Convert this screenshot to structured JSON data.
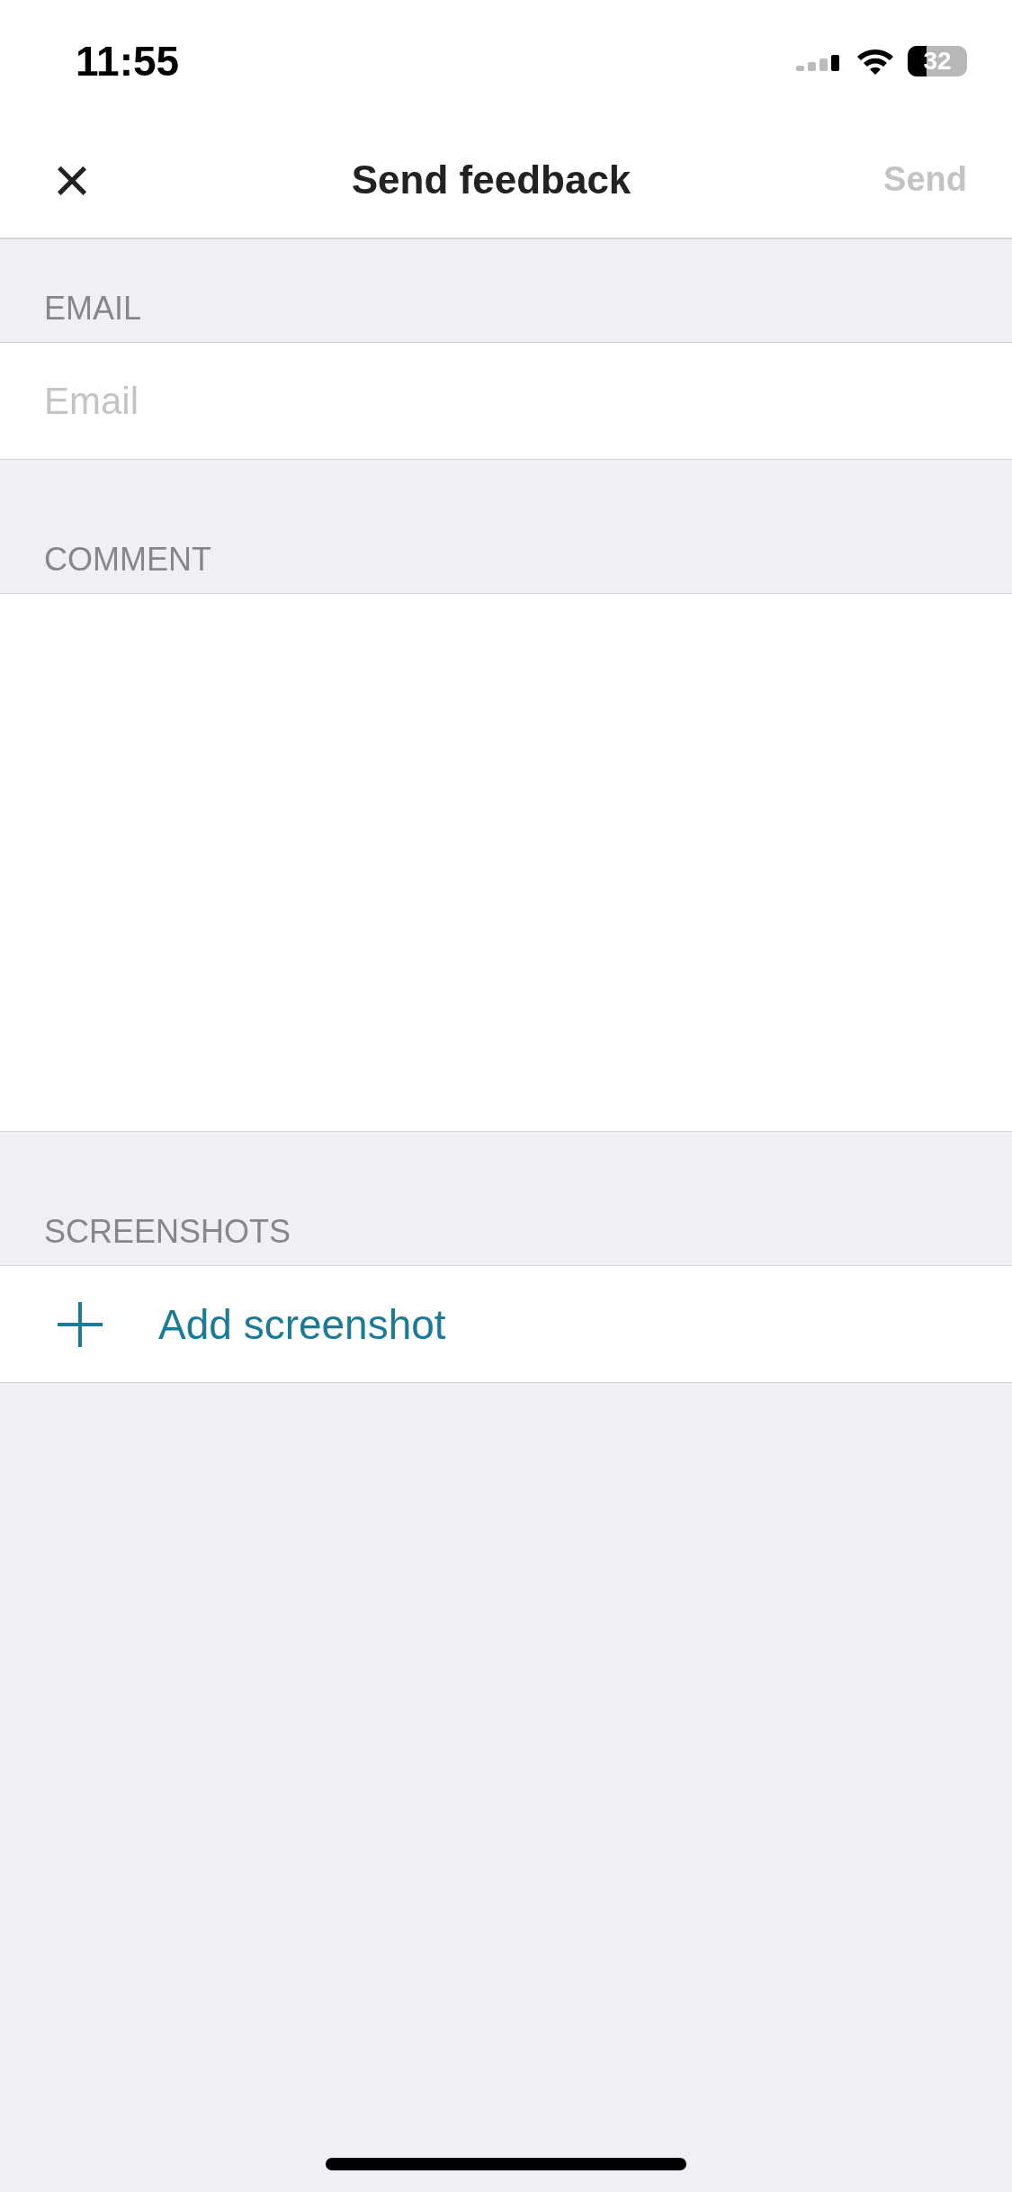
{
  "status_bar": {
    "time": "11:55",
    "battery": "32"
  },
  "nav": {
    "close": "×",
    "title": "Send feedback",
    "send": {
      "label": "Send",
      "disabled": true
    }
  },
  "sections": [
    {
      "kind": "input",
      "header": "EMAIL",
      "placeholder": "Email"
    },
    {
      "kind": "textarea",
      "header": "COMMENT"
    },
    {
      "kind": "action",
      "header": "SCREENSHOTS",
      "label": "Add screenshot"
    }
  ]
}
